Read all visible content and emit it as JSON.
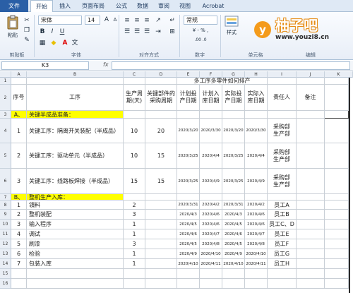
{
  "tabs": [
    "文件",
    "开始",
    "插入",
    "页面布局",
    "公式",
    "数据",
    "审阅",
    "视图",
    "Acrobat"
  ],
  "ribbon": {
    "paste": "粘贴",
    "clipboard_label": "剪贴板",
    "font_name": "宋体",
    "font_size": "14",
    "font_label": "字体",
    "align_label": "对齐方式",
    "number_format": "常规",
    "number_label": "数字",
    "style_btn": "样式",
    "cells_label": "单元格",
    "edit_label": "编辑",
    "bold": "B",
    "italic": "I",
    "underline": "U",
    "currency": "¥ - % ,",
    "decimals": ".00 .0"
  },
  "brand": {
    "logo": "y",
    "name": "柚子吧",
    "url": "www.youzi8.cn"
  },
  "formula_bar": {
    "cell_ref": "K3",
    "fx": "fx",
    "value": ""
  },
  "columns": [
    "A",
    "B",
    "C",
    "D",
    "E",
    "F",
    "G",
    "H",
    "I",
    "J",
    "K"
  ],
  "sheet": {
    "title": "多工序多零件如何排产",
    "headers": [
      "序号",
      "工序",
      "生产周期(天)",
      "关键部件的采购周期",
      "计划投产日期",
      "计划入库日期",
      "实际投产日期",
      "实际入库日期",
      "责任人",
      "备注"
    ],
    "section_a": {
      "id": "A、",
      "label": "关键半成品准备："
    },
    "key_rows": [
      {
        "no": "1",
        "process": "关键工序：隔离开关装配（半成品）",
        "cycle": "10",
        "purchase": "20",
        "plan_start": "2020/3/20",
        "plan_in": "2020/3/30",
        "act_start": "2020/3/20",
        "act_in": "2020/3/30",
        "owner": "采购部\n生产部"
      },
      {
        "no": "2",
        "process": "关键工序：驱动单元（半成品）",
        "cycle": "10",
        "purchase": "15",
        "plan_start": "2020/3/25",
        "plan_in": "2020/4/4",
        "act_start": "2020/3/25",
        "act_in": "2020/4/4",
        "owner": "采购部\n生产部"
      },
      {
        "no": "3",
        "process": "关键工序：线路板焊接（半成品）",
        "cycle": "15",
        "purchase": "15",
        "plan_start": "2020/3/25",
        "plan_in": "2020/4/9",
        "act_start": "2020/3/25",
        "act_in": "2020/4/9",
        "owner": "采购部\n生产部"
      }
    ],
    "section_b": {
      "id": "B、",
      "label": "整机生产入库："
    },
    "main_rows": [
      {
        "no": "1",
        "process": "領料",
        "cycle": "2",
        "purchase": "",
        "plan_start": "2020/3/31",
        "plan_in": "2020/4/2",
        "act_start": "2020/3/31",
        "act_in": "2020/4/2",
        "owner": "员工A"
      },
      {
        "no": "2",
        "process": "整机装配",
        "cycle": "3",
        "purchase": "",
        "plan_start": "2020/4/3",
        "plan_in": "2020/4/6",
        "act_start": "2020/4/3",
        "act_in": "2020/4/6",
        "owner": "员工B"
      },
      {
        "no": "3",
        "process": "输入程序",
        "cycle": "1",
        "purchase": "",
        "plan_start": "2020/4/5",
        "plan_in": "2020/4/6",
        "act_start": "2020/4/5",
        "act_in": "2020/4/6",
        "owner": "员工C、D"
      },
      {
        "no": "4",
        "process": "调试",
        "cycle": "1",
        "purchase": "",
        "plan_start": "2020/4/6",
        "plan_in": "2020/4/7",
        "act_start": "2020/4/6",
        "act_in": "2020/4/7",
        "owner": "员工E"
      },
      {
        "no": "5",
        "process": "刷漆",
        "cycle": "3",
        "purchase": "",
        "plan_start": "2020/4/5",
        "plan_in": "2020/4/8",
        "act_start": "2020/4/5",
        "act_in": "2020/4/8",
        "owner": "员工F"
      },
      {
        "no": "6",
        "process": "检验",
        "cycle": "1",
        "purchase": "",
        "plan_start": "2020/4/9",
        "plan_in": "2020/4/10",
        "act_start": "2020/4/9",
        "act_in": "2020/4/10",
        "owner": "员工G"
      },
      {
        "no": "7",
        "process": "包装入库",
        "cycle": "1",
        "purchase": "",
        "plan_start": "2020/4/10",
        "plan_in": "2020/4/11",
        "act_start": "2020/4/10",
        "act_in": "2020/4/11",
        "owner": "员工H"
      }
    ]
  }
}
